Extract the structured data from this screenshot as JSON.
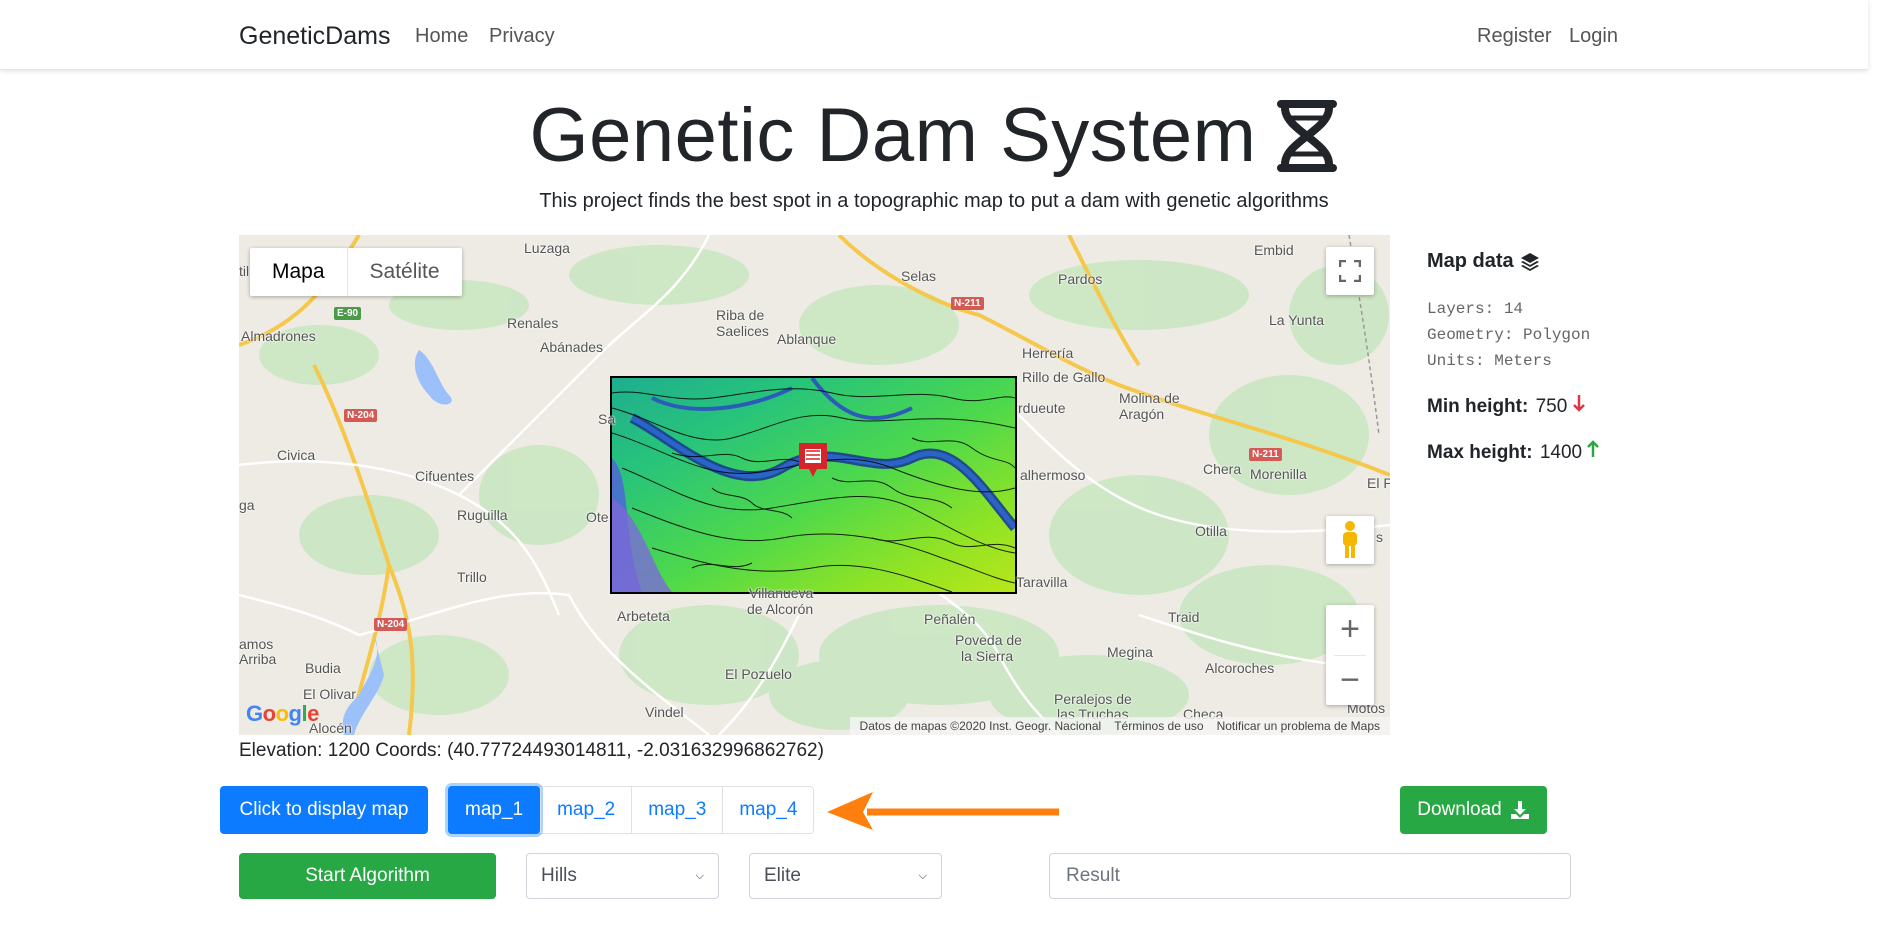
{
  "nav": {
    "brand": "GeneticDams",
    "links": [
      "Home",
      "Privacy"
    ],
    "register": "Register",
    "login": "Login"
  },
  "header": {
    "title": "Genetic Dam System",
    "title_icon": "dna-icon",
    "subtitle": "This project finds the best spot in a topographic map to put a dam with genetic algorithms"
  },
  "map": {
    "type_buttons": [
      "Mapa",
      "Satélite"
    ],
    "active_type": "Mapa",
    "places": [
      "Luzaga",
      "Selas",
      "Pardos",
      "Embid",
      "Renales",
      "Riba de",
      "Saelices",
      "Ablanque",
      "La Yunta",
      "Almadrones",
      "Abánades",
      "Herrería",
      "Rillo de Gallo",
      "Molina de",
      "Aragón",
      "Civica",
      "Cifuentes",
      "Chera",
      "Morenilla",
      "Ruguilla",
      "Otilla",
      "Trillo",
      "Villanueva",
      "de Alcorón",
      "Arbeteta",
      "Peñalén",
      "Traid",
      "Poveda de",
      "la Sierra",
      "Megina",
      "Alcoroches",
      "Budia",
      "El Olivar",
      "El Pozuelo",
      "Vindel",
      "Peralejos de",
      "las Truchas",
      "Checa",
      "Motos",
      "Alocén",
      "amos",
      "Arriba",
      "Ote",
      "Sa",
      "rdueute",
      "alhermoso",
      "Taravilla",
      "El P",
      "s",
      "ga",
      "til"
    ],
    "roads": [
      "E-90",
      "N-204",
      "N-211",
      "N-211",
      "N-204"
    ],
    "google_logo": "Google",
    "attribution": [
      "Datos de mapas ©2020 Inst. Geogr. Nacional",
      "Términos de uso",
      "Notificar un problema de Maps"
    ],
    "controls": [
      "fullscreen-icon",
      "pegman-icon",
      "zoom-in-icon",
      "zoom-out-icon"
    ]
  },
  "side_panel": {
    "title": "Map data",
    "title_icon": "layers-icon",
    "info_lines": [
      "Layers: 14",
      "Geometry: Polygon",
      "Units: Meters"
    ],
    "min_label": "Min height:",
    "min_value": "750",
    "max_label": "Max height:",
    "max_value": "1400",
    "colors": {
      "min_arrow": "#dc3545",
      "max_arrow": "#28a745"
    }
  },
  "elevation_text": "Elevation: 1200 Coords: (40.77724493014811, -2.031632996862762)",
  "controls": {
    "display_button": "Click to display map",
    "maps": [
      "map_1",
      "map_2",
      "map_3",
      "map_4"
    ],
    "active_map": "map_1",
    "download_button": "Download",
    "start_button": "Start Algorithm",
    "terrain_select": "Hills",
    "method_select": "Elite",
    "result_placeholder": "Result"
  },
  "colors": {
    "primary": "#0d7bff",
    "success": "#28a745",
    "annotation_arrow": "#ff7f0e"
  }
}
